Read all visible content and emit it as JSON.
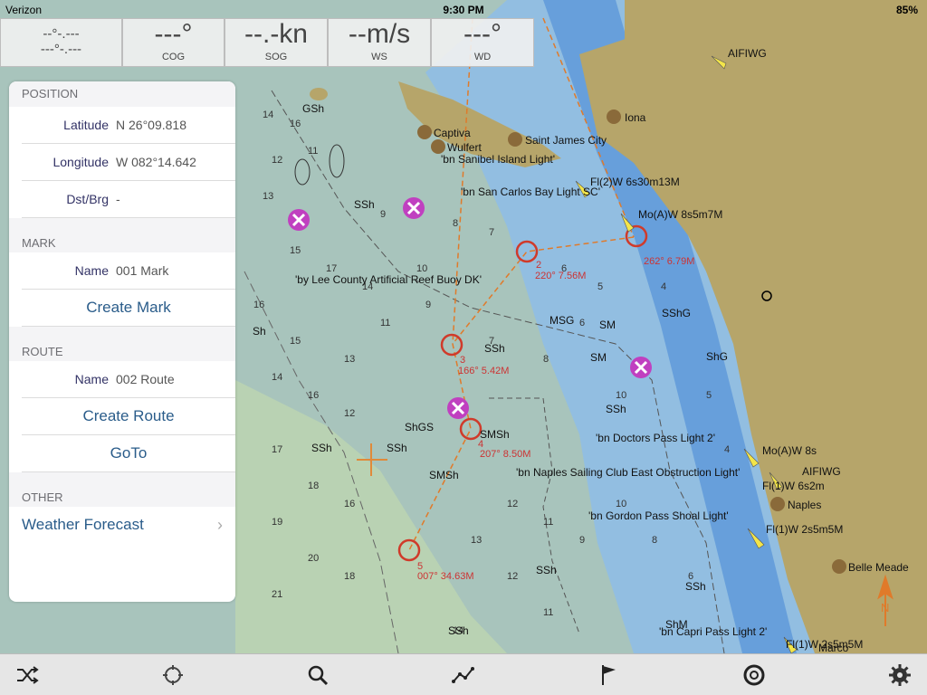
{
  "status": {
    "carrier": "Verizon",
    "time": "9:30 PM",
    "battery": "85%"
  },
  "instruments": {
    "position_line1": "--°-.---",
    "position_line2": "---°-.---",
    "cog_value": "---°",
    "cog_label": "COG",
    "sog_value": "--.-kn",
    "sog_label": "SOG",
    "ws_value": "--m/s",
    "ws_label": "WS",
    "wd_value": "---°",
    "wd_label": "WD"
  },
  "panel": {
    "position": {
      "header": "POSITION",
      "lat_label": "Latitude",
      "lat_value": "N 26°09.818",
      "lon_label": "Longitude",
      "lon_value": "W 082°14.642",
      "dst_label": "Dst/Brg",
      "dst_value": "-"
    },
    "mark": {
      "header": "MARK",
      "name_label": "Name",
      "name_value": "001 Mark",
      "create_label": "Create Mark"
    },
    "route": {
      "header": "ROUTE",
      "name_label": "Name",
      "name_value": "002 Route",
      "create_label": "Create Route",
      "goto_label": "GoTo"
    },
    "other": {
      "header": "OTHER",
      "weather_label": "Weather Forecast"
    }
  },
  "map_labels": {
    "aifiwg_top": "AIFIWG",
    "iona": "Iona",
    "captiva": "Captiva",
    "wulfert": "Wulfert",
    "saint_james": "Saint James City",
    "sanibel_light": "'bn Sanibel Island Light'",
    "fl2w": "Fl(2)W 6s30m13M",
    "san_carlos": "'bn San Carlos Bay Light SC'",
    "moaw1": "Mo(A)W 8s5m7M",
    "lee_county": "'by Lee County Artificial Reef Buoy DK'",
    "doctors_pass": "'bn Doctors Pass Light 2'",
    "moaw2": "Mo(A)W 8s",
    "aifiwg_right": "AIFIWG",
    "fl1w1": "Fl(1)W 6s2m",
    "naples_sailing": "'bn Naples Sailing Club East Obstruction Light'",
    "naples": "Naples",
    "gordon_pass": "'bn Gordon Pass Shoal Light'",
    "fl1w2": "Fl(1)W 2s5m5M",
    "belle_meade": "Belle Meade",
    "capri_pass": "'bn Capri Pass Light 2'",
    "fl1w3": "Fl(1)W 2s5m5M",
    "marco": "Marco",
    "leg2": "220° 7.56M",
    "leg_262": "262° 6.79M",
    "leg3": "166° 5.42M",
    "leg4": "207° 8.50M",
    "leg5": "007° 34.63M",
    "wp2": "2",
    "wp3": "3",
    "wp4": "4",
    "wp5": "5",
    "gsh": "GSh",
    "ssh1": "SSh",
    "ssh2": "SSh",
    "msg": "MSG",
    "sm1": "SM",
    "sm2": "SM",
    "sshg": "SShG",
    "shg": "ShG",
    "shgs": "ShGS",
    "smsh1": "SMSh",
    "smsh2": "SMSh",
    "ssh3": "SSh",
    "ssh4": "SSh",
    "ssh5": "SSh",
    "ssh6": "SSh",
    "ssh7": "SSh",
    "ssh8": "SSh",
    "sh1": "Sh",
    "shm": "ShM",
    "north": "N"
  },
  "colors": {
    "deep": "#a8c4bc",
    "shallow": "#7bb3e6",
    "veryshallow": "#4f8fd6",
    "land": "#b6a56a",
    "route": "#e07a2a",
    "waypoint": "#d03a2a"
  }
}
